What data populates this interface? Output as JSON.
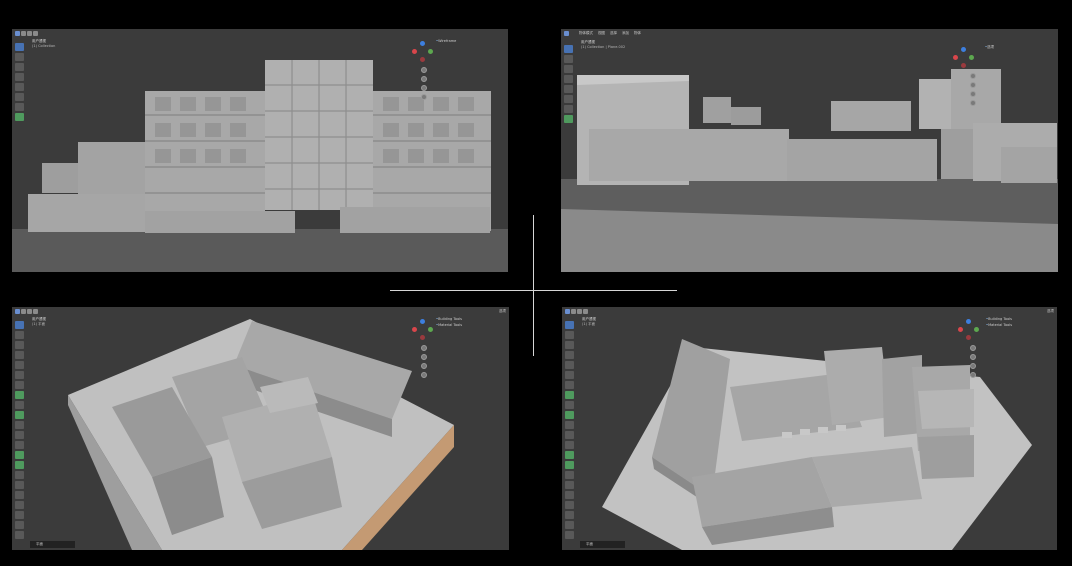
{
  "panels": [
    {
      "id": "front",
      "viewport_label": "用户透视",
      "viewport_sub": "(1) Collection",
      "overlay": [
        "Wireframe"
      ],
      "corner_tag": "",
      "menu": []
    },
    {
      "id": "street",
      "viewport_label": "用户透视",
      "viewport_sub": "(1) Collection | Plane.002",
      "overlay": [
        "选项"
      ],
      "corner_tag": "",
      "menu": [
        "物体模式",
        "视图",
        "选择",
        "添加",
        "物体"
      ]
    },
    {
      "id": "aerial-left",
      "viewport_label": "用户透视",
      "viewport_sub": "(1) 平面",
      "overlay": [
        "Building Tools",
        "Material Tools"
      ],
      "corner_tag": "选项",
      "status": "平面",
      "menu": []
    },
    {
      "id": "aerial-right",
      "viewport_label": "用户透视",
      "viewport_sub": "(1) 平面",
      "overlay": [
        "Building Tools",
        "Material Tools"
      ],
      "corner_tag": "选项",
      "status": "平面",
      "menu": []
    }
  ],
  "colors": {
    "background": "#000000",
    "viewport": "#3b3b3b",
    "model": "#a9a9a9",
    "model_shadow": "#8c8c8c",
    "ground_light": "#bdbdbd",
    "base_tan": "#c49a73",
    "accent_blue": "#4772b3",
    "axis_red": "#d9464b",
    "axis_green": "#5da84f",
    "axis_blue": "#3d7fdf"
  },
  "icons": [
    "select-box-icon",
    "cursor-icon",
    "move-icon",
    "rotate-icon",
    "scale-icon",
    "transform-icon",
    "annotate-icon",
    "measure-icon",
    "add-cube-icon",
    "hand-icon",
    "zoom-icon",
    "camera-icon",
    "grid-icon"
  ]
}
